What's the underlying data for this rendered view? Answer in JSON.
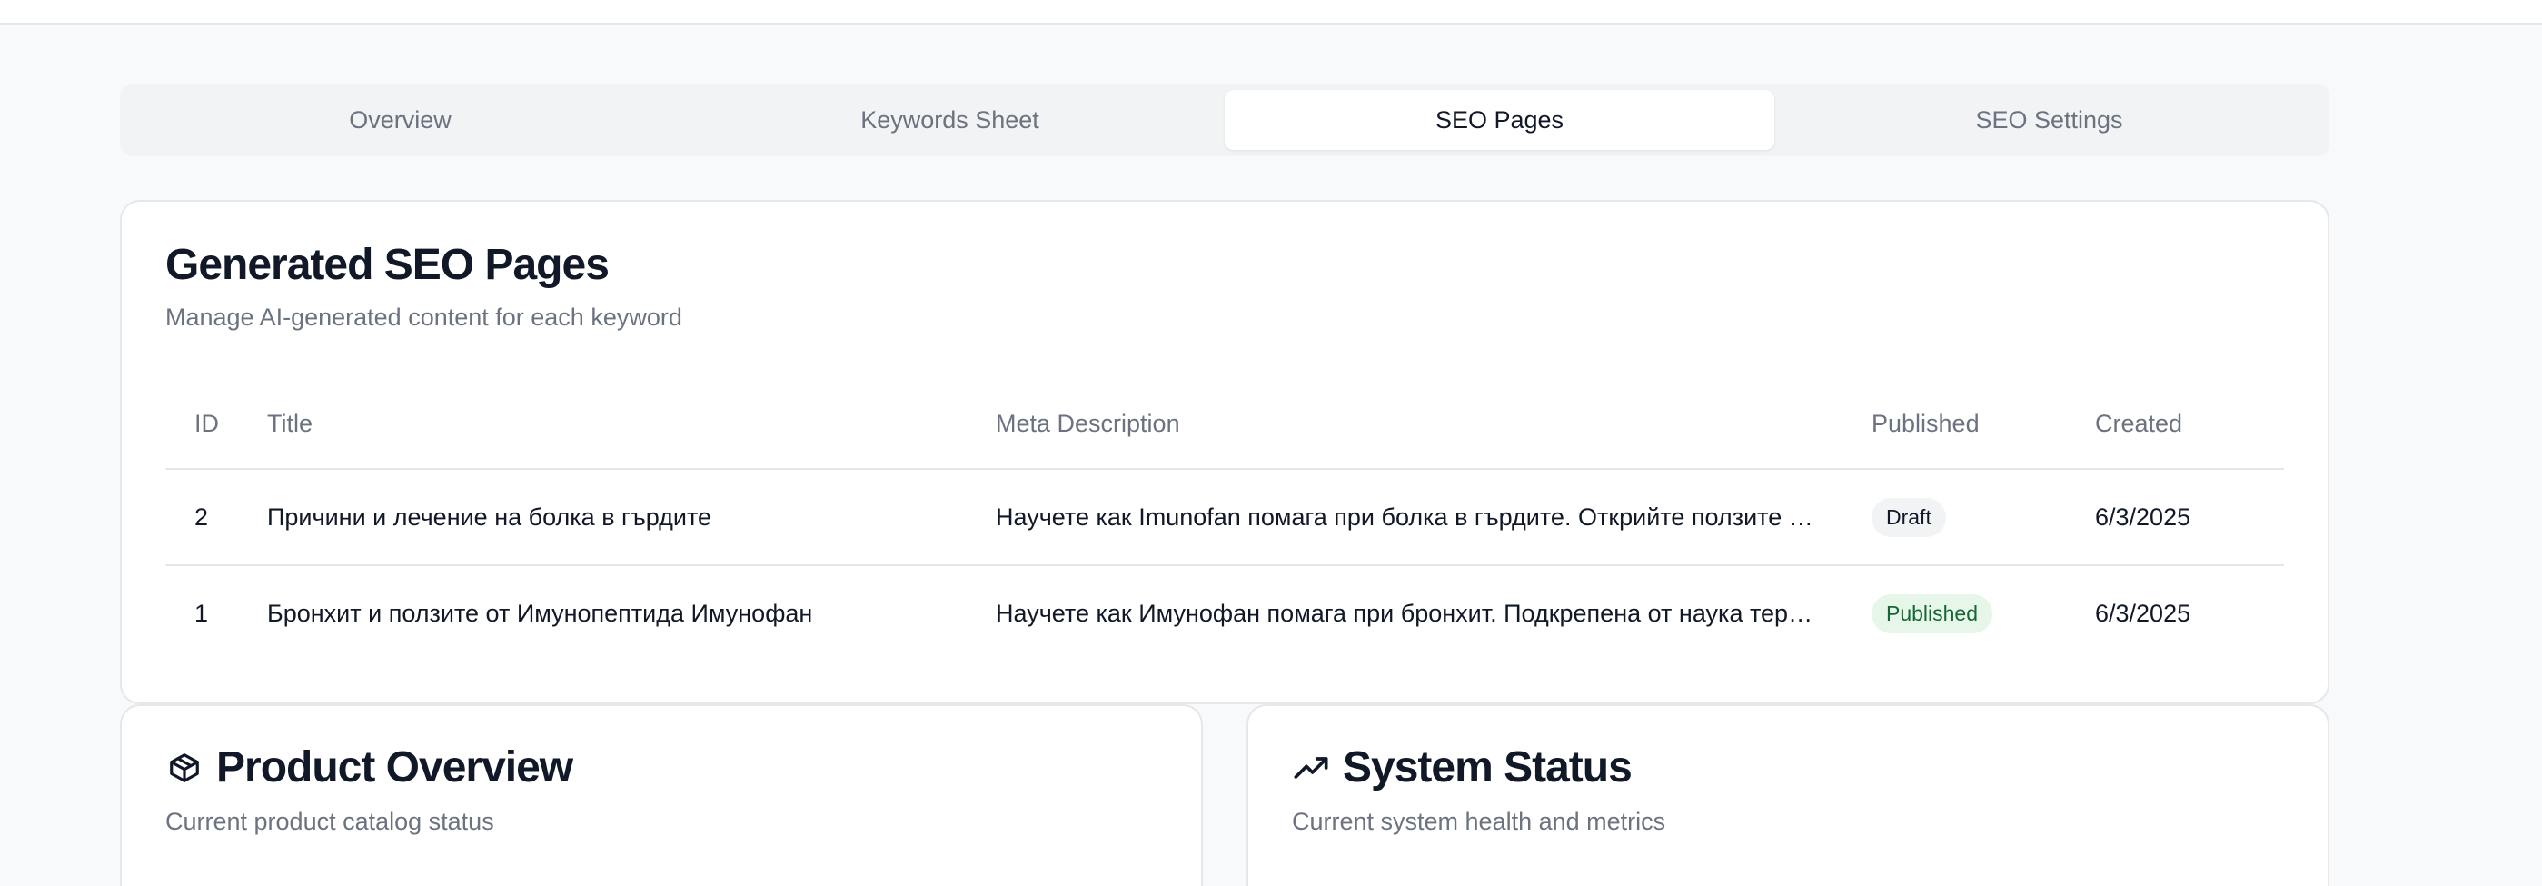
{
  "tabs": [
    {
      "label": "Overview"
    },
    {
      "label": "Keywords Sheet"
    },
    {
      "label": "SEO Pages",
      "active": true
    },
    {
      "label": "SEO Settings"
    }
  ],
  "seo_pages": {
    "title": "Generated SEO Pages",
    "subtitle": "Manage AI-generated content for each keyword",
    "columns": [
      "ID",
      "Title",
      "Meta Description",
      "Published",
      "Created"
    ],
    "rows": [
      {
        "id": "2",
        "title": "Причини и лечение на болка в гърдите",
        "meta": "Научете как Imunofan помага при болка в гърдите. Открийте ползите …",
        "status": "Draft",
        "created": "6/3/2025"
      },
      {
        "id": "1",
        "title": "Бронхит и ползите от Имунопептида Имунофан",
        "meta": "Научете как Имунофан помага при бронхит. Подкрепена от наука тера…",
        "status": "Published",
        "created": "6/3/2025"
      }
    ]
  },
  "product_overview": {
    "icon": "package-icon",
    "title": "Product Overview",
    "subtitle": "Current product catalog status"
  },
  "system_status": {
    "icon": "trending-up-icon",
    "title": "System Status",
    "subtitle": "Current system health and metrics"
  },
  "colors": {
    "badge_published_bg": "#e6f7ea",
    "badge_published_text": "#166534",
    "badge_draft_bg": "#f1f3f5"
  }
}
